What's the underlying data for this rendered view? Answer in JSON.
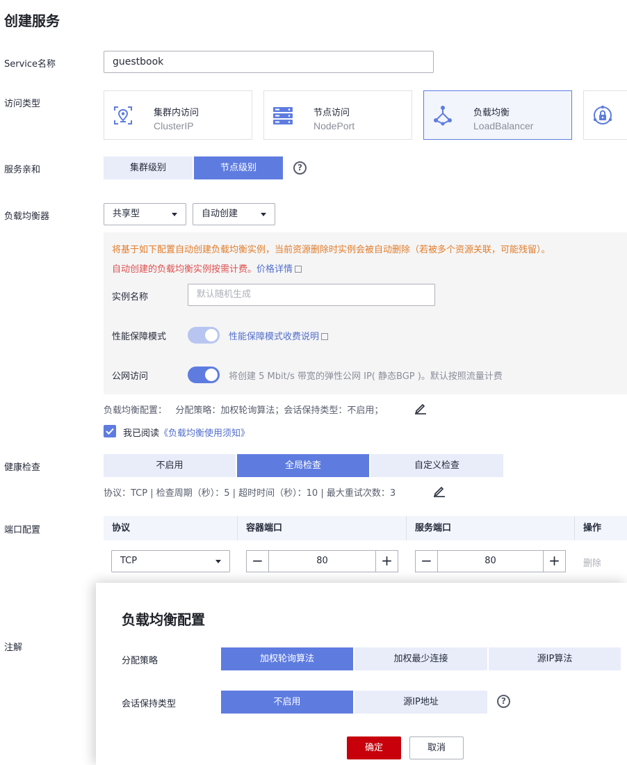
{
  "page": {
    "title": "创建服务"
  },
  "service_name": {
    "label": "Service名称",
    "value": "guestbook"
  },
  "access_type": {
    "label": "访问类型",
    "options": [
      {
        "name": "集群内访问",
        "sub": "ClusterIP",
        "icon": "cluster-ip-icon"
      },
      {
        "name": "节点访问",
        "sub": "NodePort",
        "icon": "node-port-icon"
      },
      {
        "name": "负载均衡",
        "sub": "LoadBalancer",
        "icon": "load-balancer-icon",
        "selected": true
      },
      {
        "name": "",
        "sub": "",
        "icon": "dnat-lock-icon"
      }
    ]
  },
  "affinity": {
    "label": "服务亲和",
    "options": [
      "集群级别",
      "节点级别"
    ],
    "selected": "节点级别"
  },
  "load_balancer": {
    "label": "负载均衡器",
    "type_select": "共享型",
    "mode_select": "自动创建",
    "notice_warning": "将基于如下配置自动创建负载均衡实例，当前资源删除时实例会被自动删除（若被多个资源关联，可能残留）。",
    "notice_billing": "自动创建的负载均衡实例按需计费。",
    "price_link": "价格详情",
    "instance_name_label": "实例名称",
    "instance_name_placeholder": "默认随机生成",
    "perf_mode_label": "性能保障模式",
    "perf_mode_link": "性能保障模式收费说明",
    "public_access_label": "公网访问",
    "public_access_desc": "将创建 5 Mbit/s 带宽的弹性公网 IP( 静态BGP )。默认按照流量计费",
    "config_summary": "负载均衡配置：   分配策略：加权轮询算法；会话保持类型：不启用；",
    "agree_prefix": "我已阅读",
    "agree_link": "《负载均衡使用须知》"
  },
  "health_check": {
    "label": "健康检查",
    "options": [
      "不启用",
      "全局检查",
      "自定义检查"
    ],
    "selected": "全局检查",
    "summary": "协议：TCP | 检查周期（秒）：5 | 超时时间（秒）：10 | 最大重试次数：3"
  },
  "ports": {
    "label": "端口配置",
    "headers": [
      "协议",
      "容器端口",
      "服务端口",
      "操作"
    ],
    "rows": [
      {
        "protocol": "TCP",
        "container_port": "80",
        "service_port": "80",
        "action": "删除"
      }
    ]
  },
  "annotation": {
    "label": "注解"
  },
  "dialog": {
    "title": "负载均衡配置",
    "strategy_label": "分配策略",
    "strategy_options": [
      "加权轮询算法",
      "加权最少连接",
      "源IP算法"
    ],
    "strategy_selected": "加权轮询算法",
    "session_label": "会话保持类型",
    "session_options": [
      "不启用",
      "源IP地址"
    ],
    "session_selected": "不启用",
    "ok": "确定",
    "cancel": "取消"
  },
  "colors": {
    "primary": "#5e7ce0",
    "danger": "#c7000b",
    "warning": "#e37d29"
  }
}
